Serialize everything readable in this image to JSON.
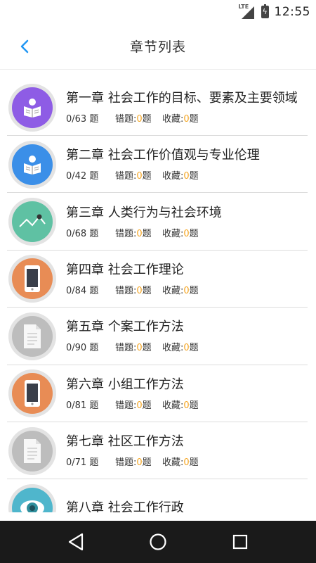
{
  "status": {
    "network": "LTE",
    "time": "12:55"
  },
  "header": {
    "title": "章节列表"
  },
  "labels": {
    "wrong": "错题:",
    "fav": "收藏:",
    "unit": "题"
  },
  "chapters": [
    {
      "title": "第一章 社会工作的目标、要素及主要领域",
      "progress": "0/63 题",
      "wrong": "0",
      "fav": "0",
      "icon": "reading-person-icon",
      "color": "#8e5ce5"
    },
    {
      "title": "第二章 社会工作价值观与专业伦理",
      "progress": "0/42 题",
      "wrong": "0",
      "fav": "0",
      "icon": "reading-person-icon",
      "color": "#3b8fe8"
    },
    {
      "title": "第三章 人类行为与社会环境",
      "progress": "0/68 题",
      "wrong": "0",
      "fav": "0",
      "icon": "line-chart-icon",
      "color": "#5fc1a3"
    },
    {
      "title": "第四章 社会工作理论",
      "progress": "0/84 题",
      "wrong": "0",
      "fav": "0",
      "icon": "phone-icon",
      "color": "#e88c55"
    },
    {
      "title": "第五章 个案工作方法",
      "progress": "0/90 题",
      "wrong": "0",
      "fav": "0",
      "icon": "document-icon",
      "color": "#bdbdbd"
    },
    {
      "title": "第六章 小组工作方法",
      "progress": "0/81 题",
      "wrong": "0",
      "fav": "0",
      "icon": "phone-icon",
      "color": "#e88c55"
    },
    {
      "title": "第七章 社区工作方法",
      "progress": "0/71 题",
      "wrong": "0",
      "fav": "0",
      "icon": "document-icon",
      "color": "#bdbdbd"
    },
    {
      "title": "第八章 社会工作行政",
      "progress": "",
      "wrong": "",
      "fav": "",
      "icon": "eye-icon",
      "color": "#4fb6cc"
    }
  ],
  "colors": {
    "accent": "#2196f3",
    "count": "#f5a623"
  }
}
